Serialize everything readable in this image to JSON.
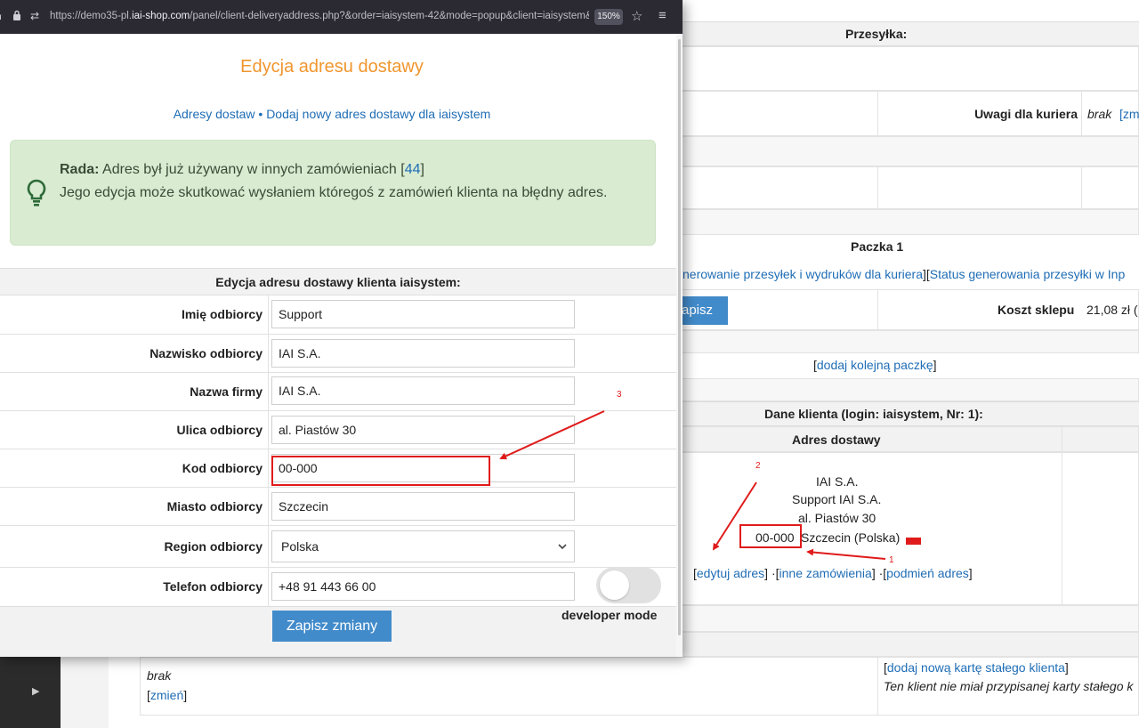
{
  "browser": {
    "url_prefix": "https://demo35-pl.",
    "url_domain": "iai-shop.com",
    "url_suffix": "/panel/client-deliveryaddress.php?&order=iaisystem-42&mode=popup&client=iaisystem&",
    "zoom": "150%"
  },
  "popup": {
    "title": "Edycja adresu dostawy",
    "breadcrumb": "Adresy dostaw • Dodaj nowy adres dostawy dla iaisystem",
    "tip": {
      "label": "Rada:",
      "line1": "Adres był już używany w innych zamówieniach [",
      "count": "44",
      "line1_end": "]",
      "line2": "Jego edycja może skutkować wysłaniem któregoś z zamówień klienta na błędny adres."
    },
    "form_title": "Edycja adresu dostawy klienta iaisystem:",
    "fields": [
      {
        "label": "Imię odbiorcy",
        "value": "Support"
      },
      {
        "label": "Nazwisko odbiorcy",
        "value": "IAI S.A."
      },
      {
        "label": "Nazwa firmy",
        "value": "IAI S.A."
      },
      {
        "label": "Ulica odbiorcy",
        "value": "al. Piastów 30"
      },
      {
        "label": "Kod odbiorcy",
        "value": "00-000"
      },
      {
        "label": "Miasto odbiorcy",
        "value": "Szczecin"
      },
      {
        "label": "Region odbiorcy",
        "value": "Polska"
      },
      {
        "label": "Telefon odbiorcy",
        "value": "+48 91 443 66 00"
      }
    ],
    "save_label": "Zapisz zmiany",
    "developer_mode_label": "developer mode",
    "developer_mode_on": false
  },
  "background": {
    "przesylka": "Przesyłka:",
    "uwagi_label": "Uwagi dla kuriera",
    "uwagi_value": "brak",
    "uwagi_link": "[zm",
    "paczka": "Paczka 1",
    "links_row_a": "nerowanie przesyłek i wydruków dla kuriera",
    "links_row_sep": "][",
    "links_row_b": "Status generowania przesyłki w Inp",
    "zapisz": "apisz",
    "koszt_label": "Koszt sklepu",
    "koszt_value": "21,08 zł (",
    "dodaj_paczke": "dodaj kolejną paczkę",
    "dane_klienta": "Dane klienta (login: iaisystem, Nr: 1):",
    "adres_dostawy": "Adres dostawy",
    "address_lines": [
      "IAI S.A.",
      "Support IAI S.A.",
      "al. Piastów 30"
    ],
    "address_zip": "00-000",
    "address_city": "Szczecin (Polska)",
    "edytuj_adres": "edytuj adres",
    "inne_zamowienia": "inne zamówienia",
    "podmien_adres": "podmień adres",
    "brak": "brak",
    "zmien": "zmień",
    "dodaj_karte": "dodaj nową kartę stałego klienta",
    "karta_info": "Ten klient nie miał przypisanej karty stałego k"
  },
  "annotations": {
    "labels": [
      "1",
      "2",
      "3"
    ],
    "color": "#e01b1b"
  }
}
